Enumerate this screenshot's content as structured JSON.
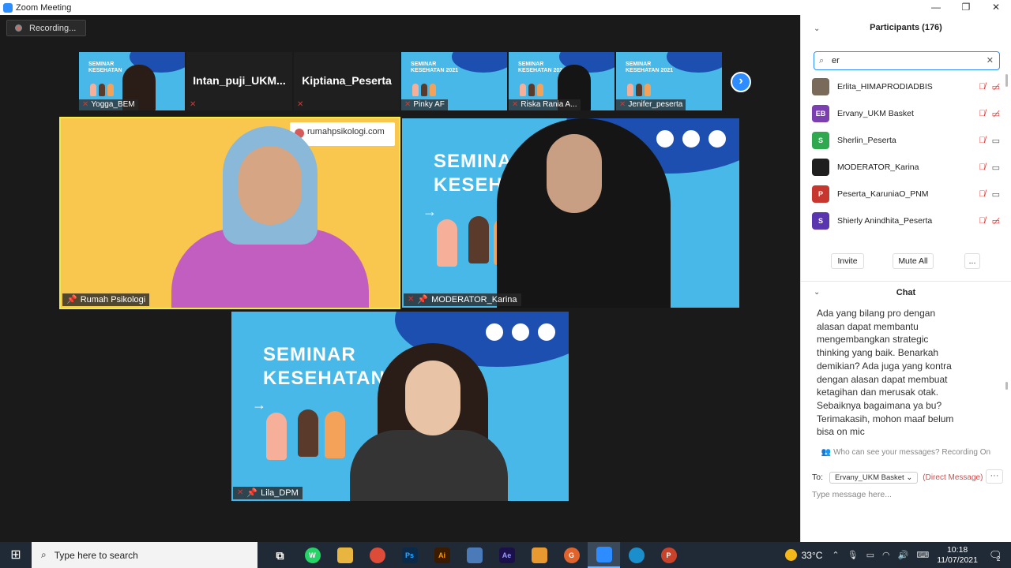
{
  "window": {
    "title": "Zoom Meeting",
    "controls": [
      "—",
      "❐",
      "✕"
    ]
  },
  "recording": {
    "label": "Recording..."
  },
  "thumbnails": [
    {
      "name": "Yogga_BEM",
      "type": "slide"
    },
    {
      "name": "Intan_puji_UKM...",
      "type": "name"
    },
    {
      "name": "Kiptiana_Peserta",
      "type": "name"
    },
    {
      "name": "Pinky AF",
      "type": "slide"
    },
    {
      "name": "Riska Rania A...",
      "type": "slide"
    },
    {
      "name": "Jenifer_peserta",
      "type": "slide"
    }
  ],
  "thumb_slide_text": "SEMINAR\nKESEHATAN 2021",
  "videos": {
    "v1": {
      "name": "Rumah Psikologi",
      "brand": "rumahpsikologi.com"
    },
    "v2": {
      "name": "MODERATOR_Karina",
      "slide_title": "SEMINAR\nKESEHAT"
    },
    "v3": {
      "name": "Lila_DPM",
      "slide_title": "SEMINAR\nKESEHATAN"
    }
  },
  "participants": {
    "header": "Participants (176)",
    "search_value": "er",
    "list": [
      {
        "name": "Erlita_HIMAPRODIADBIS",
        "initials": "",
        "color": "#7a6a5a",
        "video": "off"
      },
      {
        "name": "Ervany_UKM Basket",
        "initials": "EB",
        "color": "#7b3fb0",
        "video": "off"
      },
      {
        "name": "Sherlin_Peserta",
        "initials": "S",
        "color": "#2fa84f",
        "video": "on"
      },
      {
        "name": "MODERATOR_Karina",
        "initials": "",
        "color": "#1f1f1f",
        "video": "on"
      },
      {
        "name": "Peserta_KaruniaO_PNM",
        "initials": "P",
        "color": "#c8372d",
        "video": "on"
      },
      {
        "name": "Shierly Anindhita_Peserta",
        "initials": "S",
        "color": "#5a35b0",
        "video": "off"
      }
    ],
    "buttons": {
      "invite": "Invite",
      "mute_all": "Mute All",
      "more": "..."
    }
  },
  "chat": {
    "header": "Chat",
    "message": "Ada yang bilang pro dengan alasan dapat membantu mengembangkan strategic thinking yang baik. Benarkah demikian? Ada juga yang kontra dengan alasan dapat membuat ketagihan dan merusak otak. Sebaiknya bagaimana ya bu? Terimakasih, mohon maaf belum bisa on mic",
    "privacy": "Who can see your messages? Recording On",
    "to_label": "To:",
    "to_value": "Ervany_UKM Basket",
    "direct": "(Direct Message)",
    "more": "···",
    "placeholder": "Type message here..."
  },
  "taskbar": {
    "search_placeholder": "Type here to search",
    "apps": [
      {
        "name": "task-view",
        "label": "⧉",
        "color": "#1f2a36"
      },
      {
        "name": "whatsapp",
        "label": "W",
        "color": "#25d366"
      },
      {
        "name": "file-explorer",
        "label": "📁",
        "color": "#e8b640"
      },
      {
        "name": "chrome",
        "label": "●",
        "color": "#dd4b39"
      },
      {
        "name": "photoshop",
        "label": "Ps",
        "color": "#0b2a4a"
      },
      {
        "name": "illustrator",
        "label": "Ai",
        "color": "#3a1b00"
      },
      {
        "name": "app-generic",
        "label": "▤",
        "color": "#4a7ab8"
      },
      {
        "name": "after-effects",
        "label": "Ae",
        "color": "#1b1049"
      },
      {
        "name": "media-player",
        "label": "▶",
        "color": "#e89a30"
      },
      {
        "name": "grammarly",
        "label": "G",
        "color": "#e0632c"
      },
      {
        "name": "zoom",
        "label": "■",
        "color": "#2d8cff"
      },
      {
        "name": "edge",
        "label": "e",
        "color": "#1a8fcc"
      },
      {
        "name": "powerpoint",
        "label": "P",
        "color": "#c9422a"
      }
    ],
    "temperature": "33°C",
    "time": "10:18",
    "date": "11/07/2021",
    "notifications": "2"
  }
}
